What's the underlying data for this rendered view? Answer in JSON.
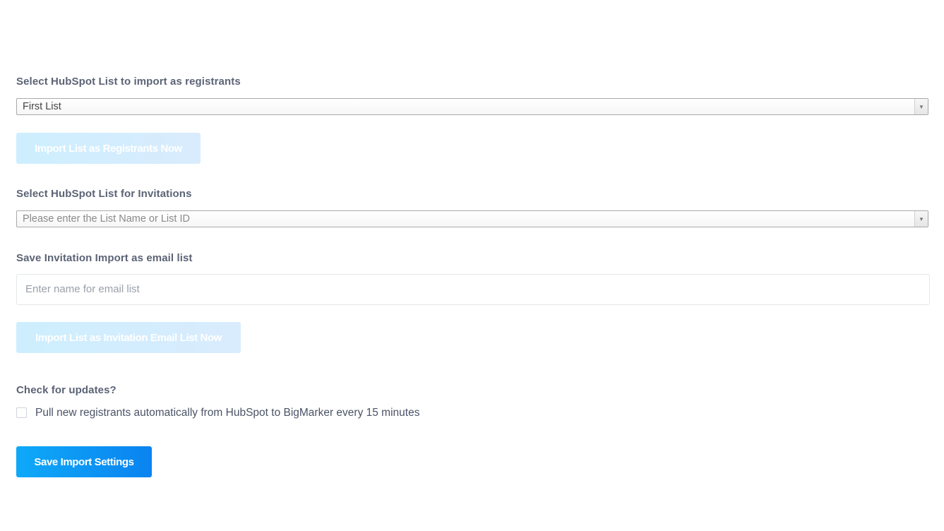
{
  "registrants": {
    "label": "Select HubSpot List to import as registrants",
    "select_value": "First List",
    "import_button": "Import List as Registrants Now"
  },
  "invitations": {
    "label": "Select HubSpot List for Invitations",
    "select_placeholder": "Please enter the List Name or List ID"
  },
  "email_list": {
    "label": "Save Invitation Import as email list",
    "input_placeholder": "Enter name for email list",
    "import_button": "Import List as Invitation Email List Now"
  },
  "updates": {
    "label": "Check for updates?",
    "checkbox_label": "Pull new registrants automatically from HubSpot to BigMarker every 15 minutes",
    "checked": false
  },
  "save_button": "Save Import Settings",
  "icons": {
    "dropdown": "chevron-down-icon"
  },
  "colors": {
    "primary": "#0a8ff2",
    "disabled": "#d4edfe",
    "label": "#5b6375"
  }
}
